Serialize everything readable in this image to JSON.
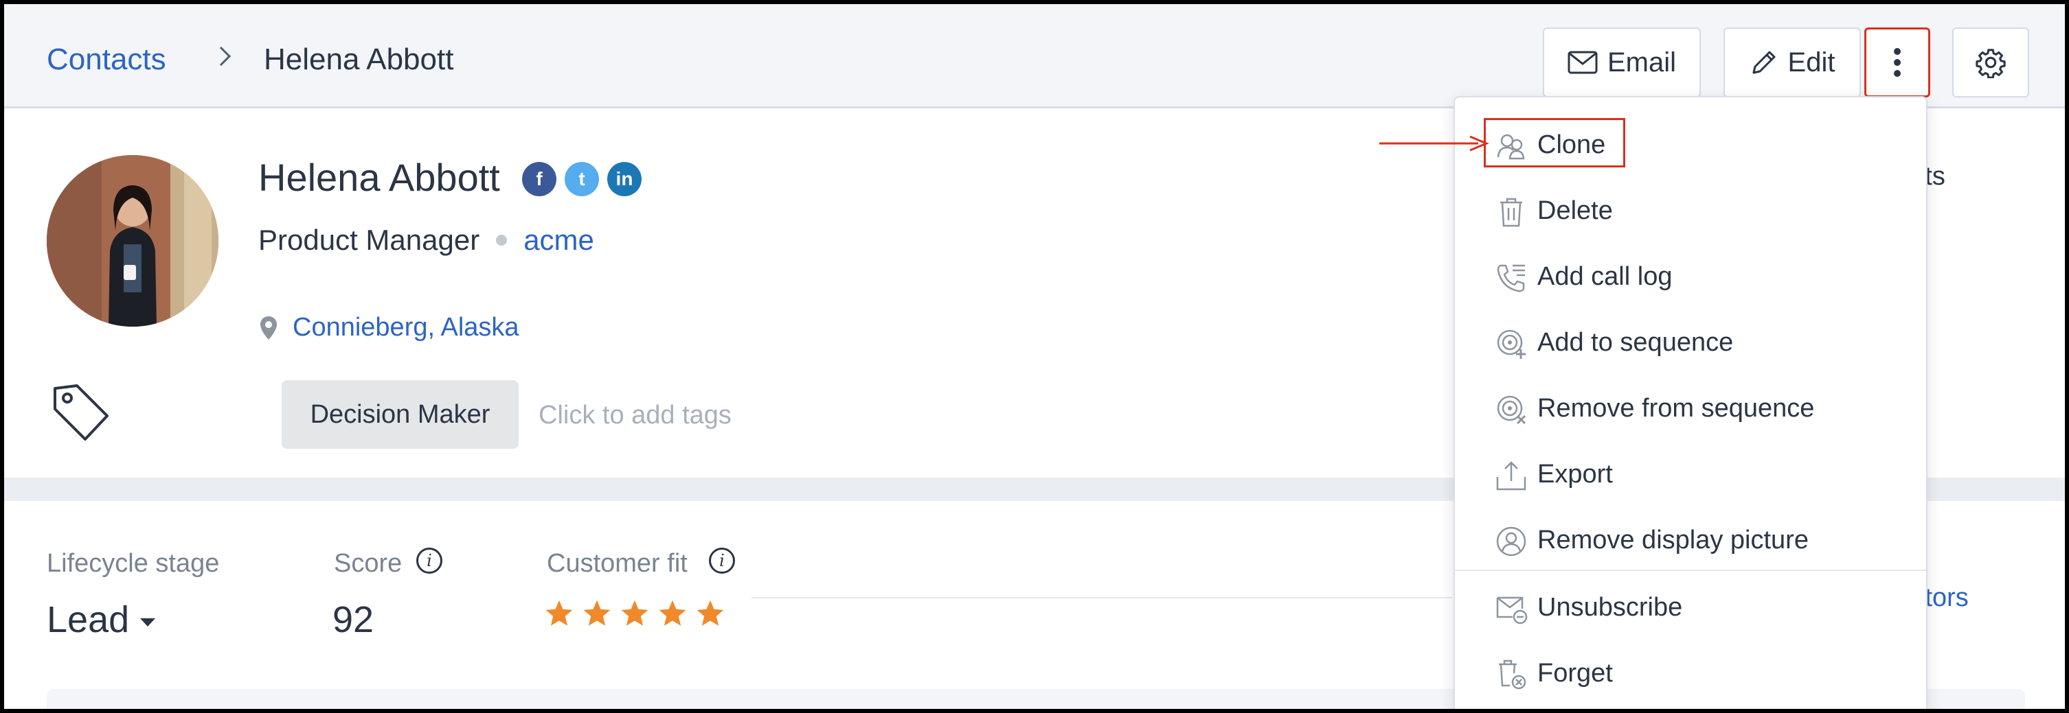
{
  "breadcrumb": {
    "parent": "Contacts",
    "current": "Helena Abbott"
  },
  "actions": {
    "email_label": "Email",
    "edit_label": "Edit"
  },
  "contact": {
    "name": "Helena Abbott",
    "job_title": "Product Manager",
    "company": "acme",
    "location": "Connieberg, Alaska",
    "social": {
      "facebook": "f",
      "twitter": "t",
      "linkedin": "in"
    }
  },
  "tags": {
    "items": [
      "Decision Maker"
    ],
    "placeholder": "Click to add tags"
  },
  "side_peek": {
    "accounts": "unts"
  },
  "stats": {
    "lifecycle_label": "Lifecycle stage",
    "lifecycle_value": "Lead",
    "score_label": "Score",
    "score_value": "92",
    "fit_label": "Customer fit",
    "fit_stars": 5,
    "fit_max": 5,
    "factors_link": "g factors"
  },
  "menu": {
    "items": [
      {
        "label": "Clone",
        "icon": "clone-icon"
      },
      {
        "label": "Delete",
        "icon": "trash-icon"
      },
      {
        "label": "Add call log",
        "icon": "call-log-icon"
      },
      {
        "label": "Add to sequence",
        "icon": "sequence-add-icon"
      },
      {
        "label": "Remove from sequence",
        "icon": "sequence-remove-icon"
      },
      {
        "label": "Export",
        "icon": "export-icon"
      },
      {
        "label": "Remove display picture",
        "icon": "user-circle-icon"
      },
      {
        "label": "Unsubscribe",
        "icon": "unsubscribe-icon"
      },
      {
        "label": "Forget",
        "icon": "forget-icon"
      }
    ]
  },
  "colors": {
    "accent": "#2c64c3",
    "highlight": "#d7311f",
    "star": "#f0892a",
    "header_bg": "#f3f5f8"
  }
}
